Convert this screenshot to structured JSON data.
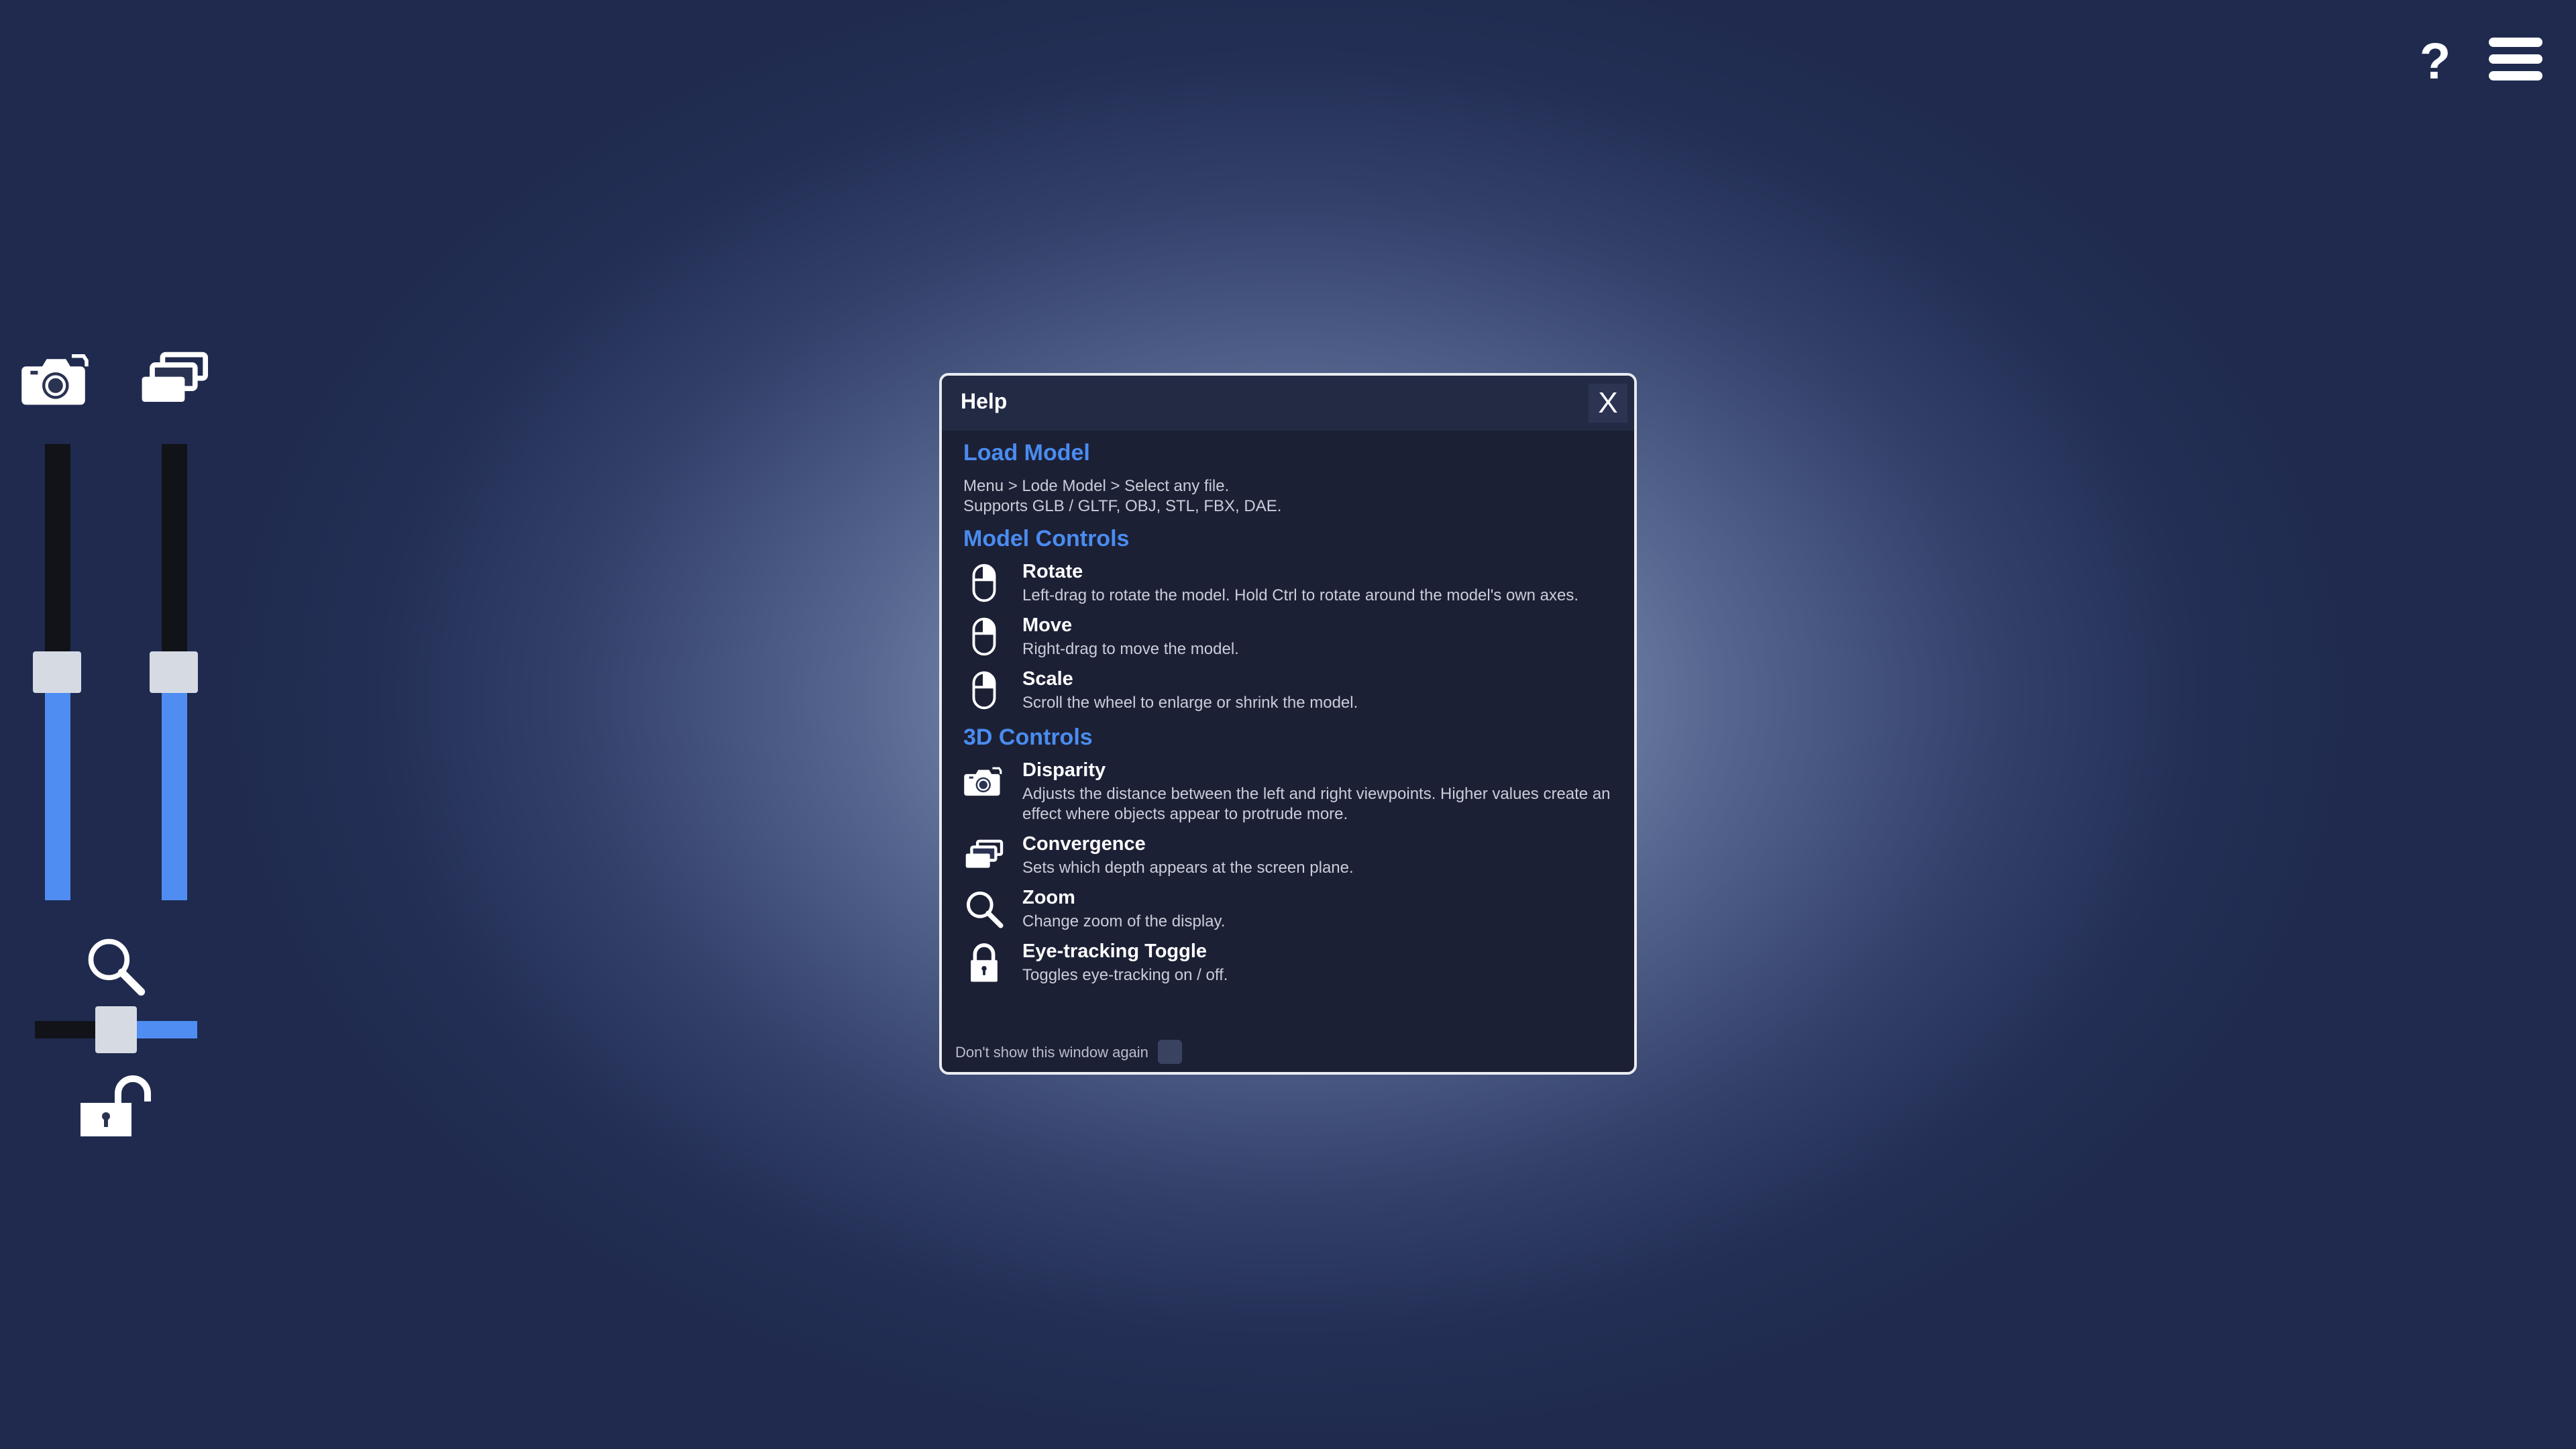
{
  "topbar": {
    "help_icon": "question-mark-icon",
    "help_glyph": "?",
    "menu_icon": "hamburger-menu-icon"
  },
  "left_panel": {
    "disparity_icon": "camera-icon",
    "convergence_icon": "stacked-layers-icon",
    "disparity_level": 0.5,
    "convergence_level": 0.5,
    "zoom_icon": "magnifier-icon",
    "zoom_level": 0.5,
    "eye_tracking_icon": "unlocked-padlock-icon"
  },
  "colors": {
    "accent": "#4f8df3",
    "heading": "#4a8cf0",
    "dialog_bg": "#1c2035",
    "slider_track": "#111318",
    "slider_thumb": "#d6dae3"
  },
  "dialog": {
    "title": "Help",
    "close_label": "X",
    "sections": {
      "load_model": {
        "heading": "Load Model",
        "line1": "Menu > Lode Model > Select any file.",
        "line2": "Supports GLB / GLTF, OBJ, STL, FBX, DAE."
      },
      "model_controls": {
        "heading": "Model Controls",
        "items": [
          {
            "icon": "mouse-icon",
            "title": "Rotate",
            "description": "Left-drag to rotate the model. Hold Ctrl to rotate around the model's own axes."
          },
          {
            "icon": "mouse-icon",
            "title": "Move",
            "description": "Right-drag to move the model."
          },
          {
            "icon": "mouse-icon",
            "title": "Scale",
            "description": "Scroll the wheel to enlarge or shrink the model."
          }
        ]
      },
      "controls_3d": {
        "heading": "3D Controls",
        "items": [
          {
            "icon": "camera-icon",
            "title": "Disparity",
            "description": "Adjusts the distance between the left and right viewpoints. Higher values create an effect where objects appear to protrude more."
          },
          {
            "icon": "stacked-layers-icon",
            "title": "Convergence",
            "description": "Sets which depth appears at the screen plane."
          },
          {
            "icon": "magnifier-icon",
            "title": "Zoom",
            "description": "Change zoom of the display."
          },
          {
            "icon": "locked-padlock-icon",
            "title": "Eye-tracking Toggle",
            "description": "Toggles eye-tracking on / off."
          }
        ]
      }
    },
    "footer": {
      "dont_show_label": "Don't show this window again",
      "dont_show_checked": false
    }
  }
}
